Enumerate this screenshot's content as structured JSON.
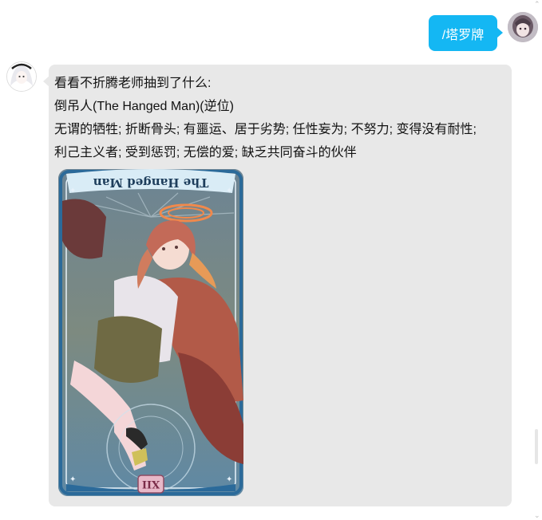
{
  "conversation": {
    "outgoing": {
      "text": "/塔罗牌"
    },
    "incoming": {
      "lines": [
        "看看不折腾老师抽到了什么:",
        "倒吊人(The Hanged Man)(逆位)",
        "无谓的牺牲; 折断骨头; 有噩运、居于劣势; 任性妄为; 不努力; 变得没有耐性;",
        "利己主义者; 受到惩罚; 无偿的爱; 缺乏共同奋斗的伙伴"
      ],
      "card": {
        "title": "The Hanged Man",
        "numeral": "XII",
        "orientation": "reversed"
      }
    }
  },
  "colors": {
    "outgoing_bubble": "#14b7f3",
    "incoming_bubble": "#e8e8e8"
  }
}
